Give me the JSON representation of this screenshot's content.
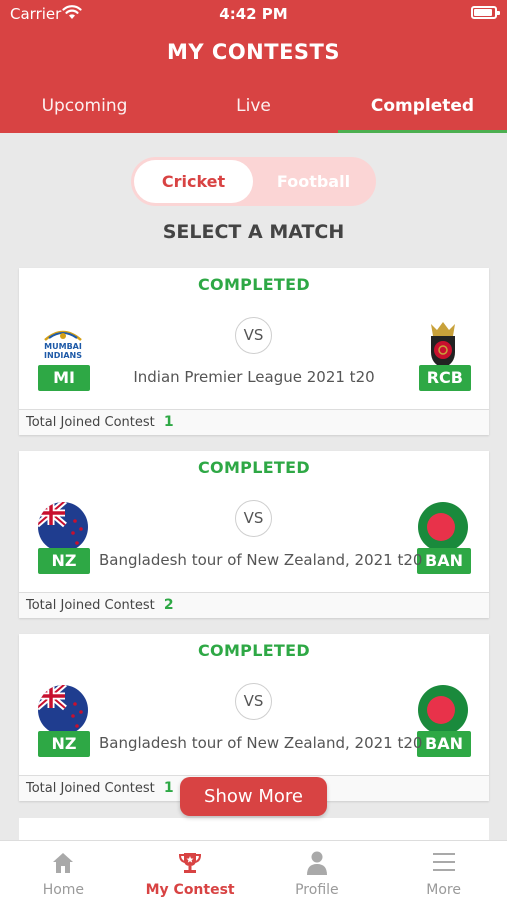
{
  "status_bar": {
    "carrier": "Carrier",
    "time": "4:42 PM"
  },
  "header": {
    "title": "MY CONTESTS"
  },
  "tabs": [
    {
      "label": "Upcoming",
      "active": false
    },
    {
      "label": "Live",
      "active": false
    },
    {
      "label": "Completed",
      "active": true
    }
  ],
  "sport_toggle": {
    "cricket": "Cricket",
    "football": "Football",
    "selected": "Cricket"
  },
  "section_title": "SELECT A MATCH",
  "vs_label": "VS",
  "footer_label": "Total Joined Contest",
  "matches": [
    {
      "status": "COMPLETED",
      "team1": "MI",
      "team2": "RCB",
      "league": "Indian Premier League 2021 t20",
      "joined": "1",
      "team1_logo": "mumbai-indians-logo",
      "team2_logo": "rcb-logo"
    },
    {
      "status": "COMPLETED",
      "team1": "NZ",
      "team2": "BAN",
      "league": "Bangladesh tour of New Zealand, 2021 t20",
      "joined": "2",
      "team1_logo": "nz-flag",
      "team2_logo": "bangladesh-flag"
    },
    {
      "status": "COMPLETED",
      "team1": "NZ",
      "team2": "BAN",
      "league": "Bangladesh tour of New Zealand, 2021 t20",
      "joined": "1",
      "team1_logo": "nz-flag",
      "team2_logo": "bangladesh-flag"
    }
  ],
  "show_more": "Show More",
  "bottom_nav": [
    {
      "label": "Home",
      "icon": "home-icon",
      "active": false
    },
    {
      "label": "My Contest",
      "icon": "trophy-icon",
      "active": true
    },
    {
      "label": "Profile",
      "icon": "person-icon",
      "active": false
    },
    {
      "label": "More",
      "icon": "menu-icon",
      "active": false
    }
  ],
  "colors": {
    "primary": "#d84343",
    "success": "#2ea845",
    "background": "#e9e9e9"
  }
}
